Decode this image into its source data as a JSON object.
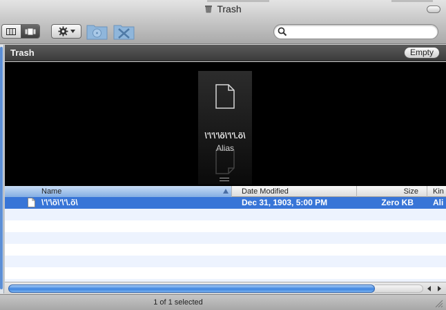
{
  "window": {
    "title": "Trash",
    "title_icon": "trash-icon"
  },
  "toolbar": {
    "view_segments": [
      "columns-view-icon",
      "cover-flow-view-icon"
    ],
    "action_icon": "gear-icon",
    "search": {
      "value": "",
      "placeholder": ""
    },
    "disabled_buttons": [
      "burn-folder-icon",
      "utilities-folder-icon"
    ]
  },
  "path_bar": {
    "title": "Trash",
    "empty_label": "Empty"
  },
  "cover_flow": {
    "selected_name": "\\'\\'\\'\\õ\\'\\'\\.õ\\",
    "selected_kind": "Alias"
  },
  "list": {
    "columns": [
      "Name",
      "Date Modified",
      "Size",
      "Kin"
    ],
    "sorted_column": "Name",
    "rows": [
      {
        "name": "\\'\\'\\õ\\'\\'\\.õ\\",
        "date": "Dec 31, 1903, 5:00 PM",
        "size": "Zero KB",
        "kind": "Ali",
        "selected": true
      }
    ]
  },
  "status": {
    "text": "1 of 1 selected"
  },
  "colors": {
    "selection": "#3875d7",
    "alt_row": "#edf3fe",
    "coverflow_bg": "#000000",
    "scroll_thumb": "#3e85e0"
  }
}
